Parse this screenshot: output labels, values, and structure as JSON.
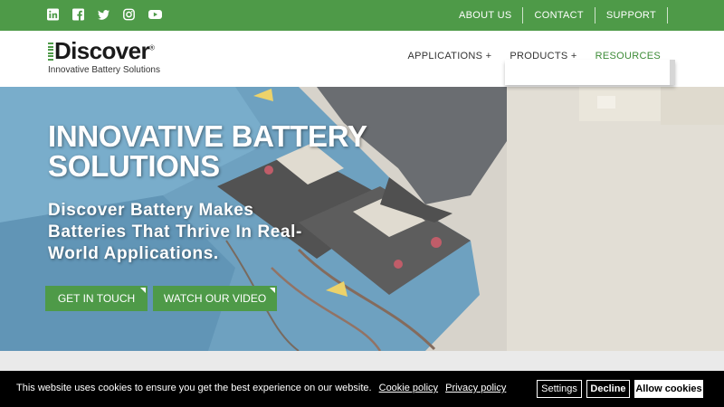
{
  "topbar": {
    "social_icons": [
      "linkedin-icon",
      "facebook-icon",
      "twitter-icon",
      "instagram-icon",
      "youtube-icon"
    ],
    "links": [
      "ABOUT US",
      "CONTACT",
      "SUPPORT"
    ],
    "background": "#4e9a48"
  },
  "header": {
    "logo_text": "Discover",
    "logo_registered": "®",
    "logo_tagline": "Innovative Battery Solutions",
    "nav": [
      "APPLICATIONS +",
      "PRODUCTS +",
      "RESOURCES"
    ]
  },
  "hero": {
    "title": "INNOVATIVE BATTERY SOLUTIONS",
    "subtitle": "Discover Battery Makes Batteries That  Thrive In Real-World Applications.",
    "buttons": {
      "get_in_touch": "GET IN TOUCH",
      "watch_video": "WATCH OUR VIDEO"
    }
  },
  "cookie_bar": {
    "message": "This website uses cookies to ensure you get the best experience on our website.",
    "cookie_policy": "Cookie policy",
    "privacy_policy": "Privacy policy",
    "settings": "Settings",
    "decline": "Decline",
    "allow": "Allow cookies"
  },
  "colors": {
    "brand_green": "#4e9a48",
    "active_nav": "#3d8b37"
  }
}
